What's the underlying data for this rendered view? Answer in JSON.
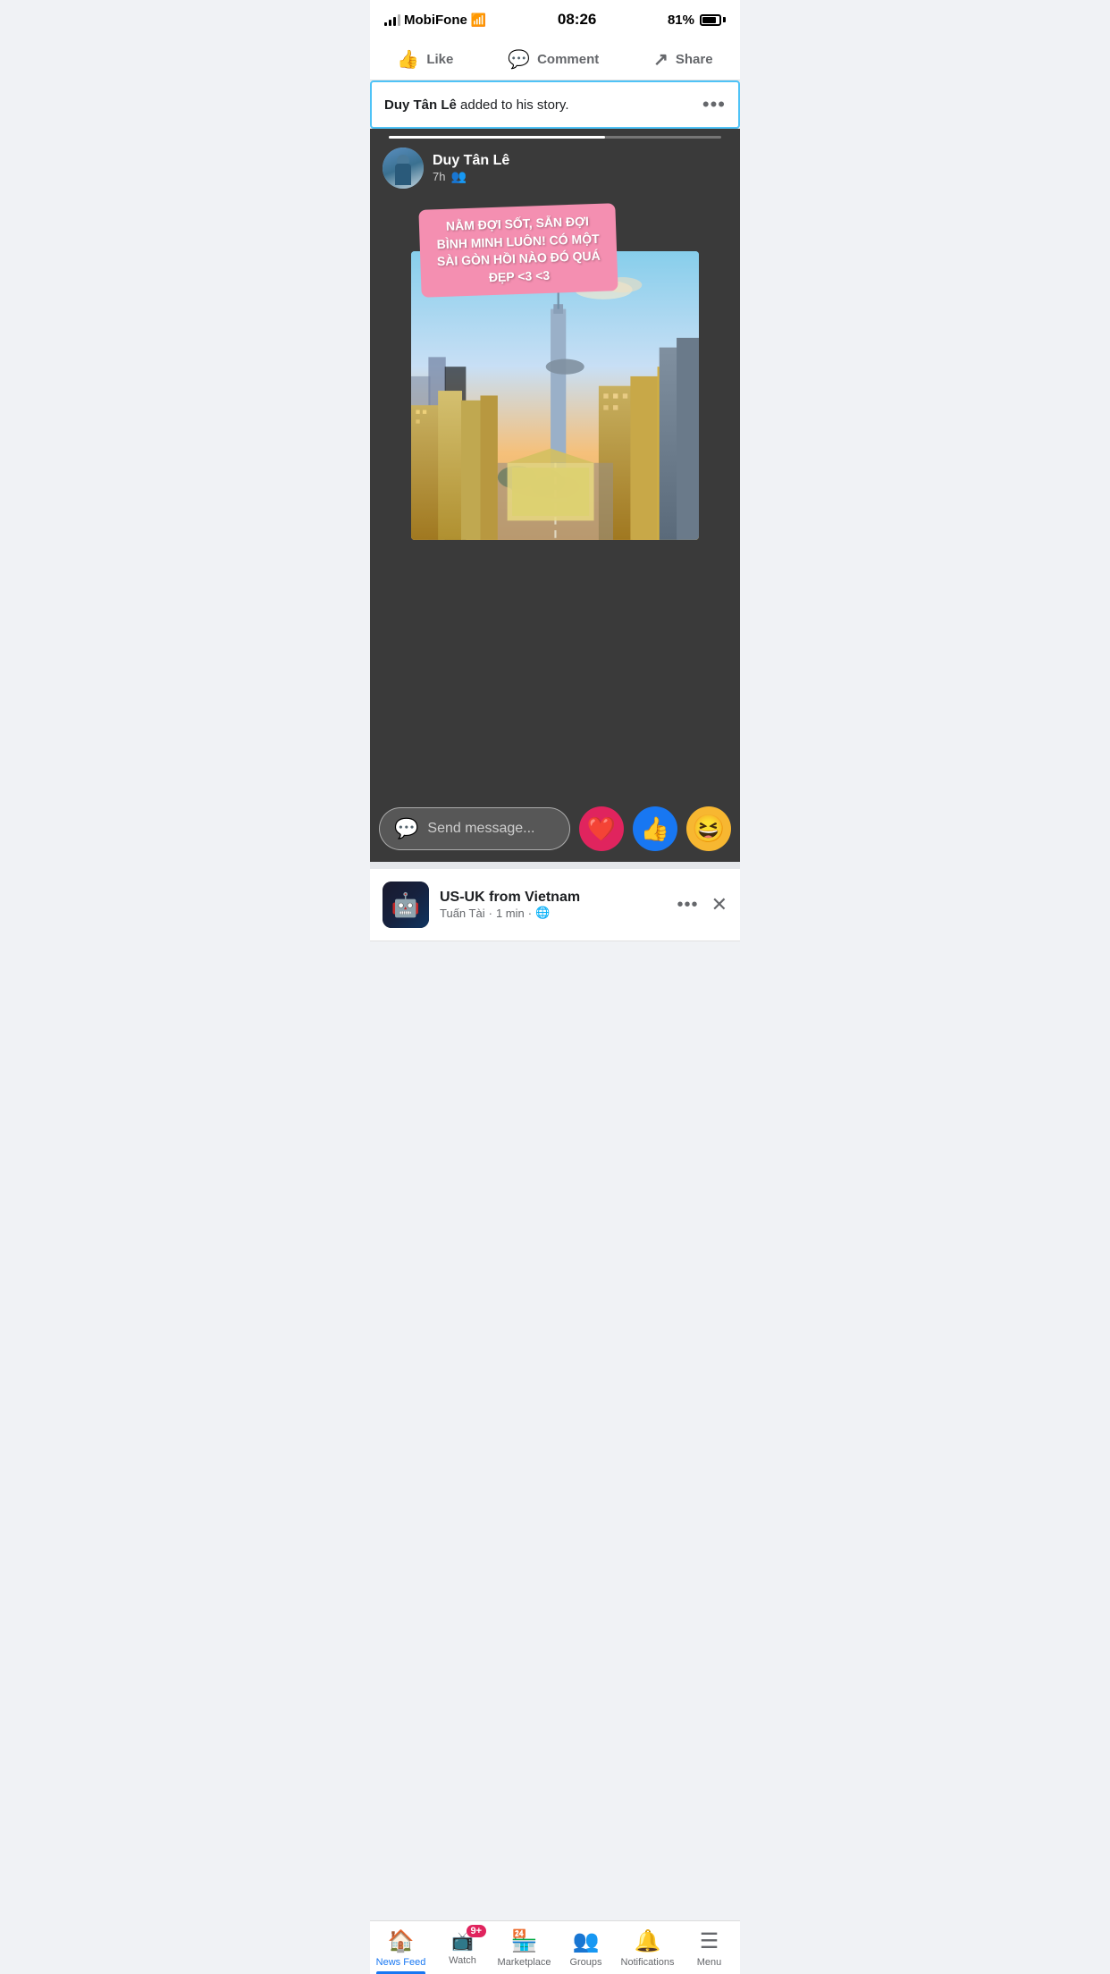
{
  "statusBar": {
    "carrier": "MobiFone",
    "time": "08:26",
    "battery": "81%"
  },
  "actionBar": {
    "like": "Like",
    "comment": "Comment",
    "share": "Share"
  },
  "storyNotification": {
    "userName": "Duy Tân Lê",
    "actionText": " added to his story.",
    "moreIcon": "•••"
  },
  "storyViewer": {
    "userName": "Duy Tân Lê",
    "timeAgo": "7h",
    "overlayText": "NẰM ĐỢI SỐT, SẴN ĐỢI BÌNH MINH LUÔN! CÓ MỘT SÀI GÒN HỒI NÀO ĐÓ QUÁ ĐẸP <3 <3",
    "messagePlaceholder": "Send message..."
  },
  "nextPost": {
    "groupName": "US-UK  from Vietnam",
    "poster": "Tuấn Tài",
    "timeAgo": "1 min",
    "privacy": "🌐"
  },
  "bottomNav": {
    "items": [
      {
        "id": "news-feed",
        "label": "News Feed",
        "icon": "🏠",
        "active": true,
        "badge": null
      },
      {
        "id": "watch",
        "label": "Watch",
        "icon": "▶",
        "active": false,
        "badge": "9+"
      },
      {
        "id": "marketplace",
        "label": "Marketplace",
        "icon": "🏪",
        "active": false,
        "badge": null
      },
      {
        "id": "groups",
        "label": "Groups",
        "icon": "👥",
        "active": false,
        "badge": null
      },
      {
        "id": "notifications",
        "label": "Notifications",
        "icon": "🔔",
        "active": false,
        "badge": null
      },
      {
        "id": "menu",
        "label": "Menu",
        "icon": "☰",
        "active": false,
        "badge": null
      }
    ]
  }
}
